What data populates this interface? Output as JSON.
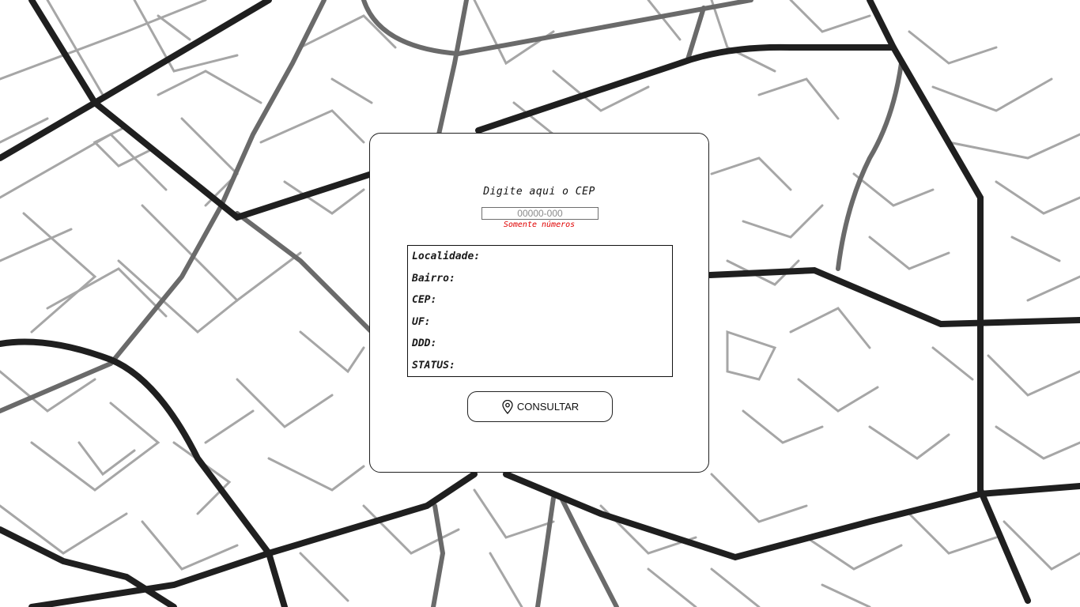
{
  "form": {
    "title": "Digite aqui o CEP",
    "cep_placeholder": "00000-000",
    "cep_value": "",
    "hint": "Somente números"
  },
  "result": {
    "localidade_label": "Localidade:",
    "bairro_label": "Bairro:",
    "cep_label": "CEP:",
    "uf_label": "UF:",
    "ddd_label": "DDD:",
    "status_label": "STATUS:"
  },
  "button": {
    "label": "CONSULTAR",
    "icon": "map-pin-icon"
  },
  "colors": {
    "hint": "#e00000",
    "major_road": "#1f1f1f",
    "medium_road": "#6a6a6a",
    "minor_road": "#a8a8a8"
  }
}
